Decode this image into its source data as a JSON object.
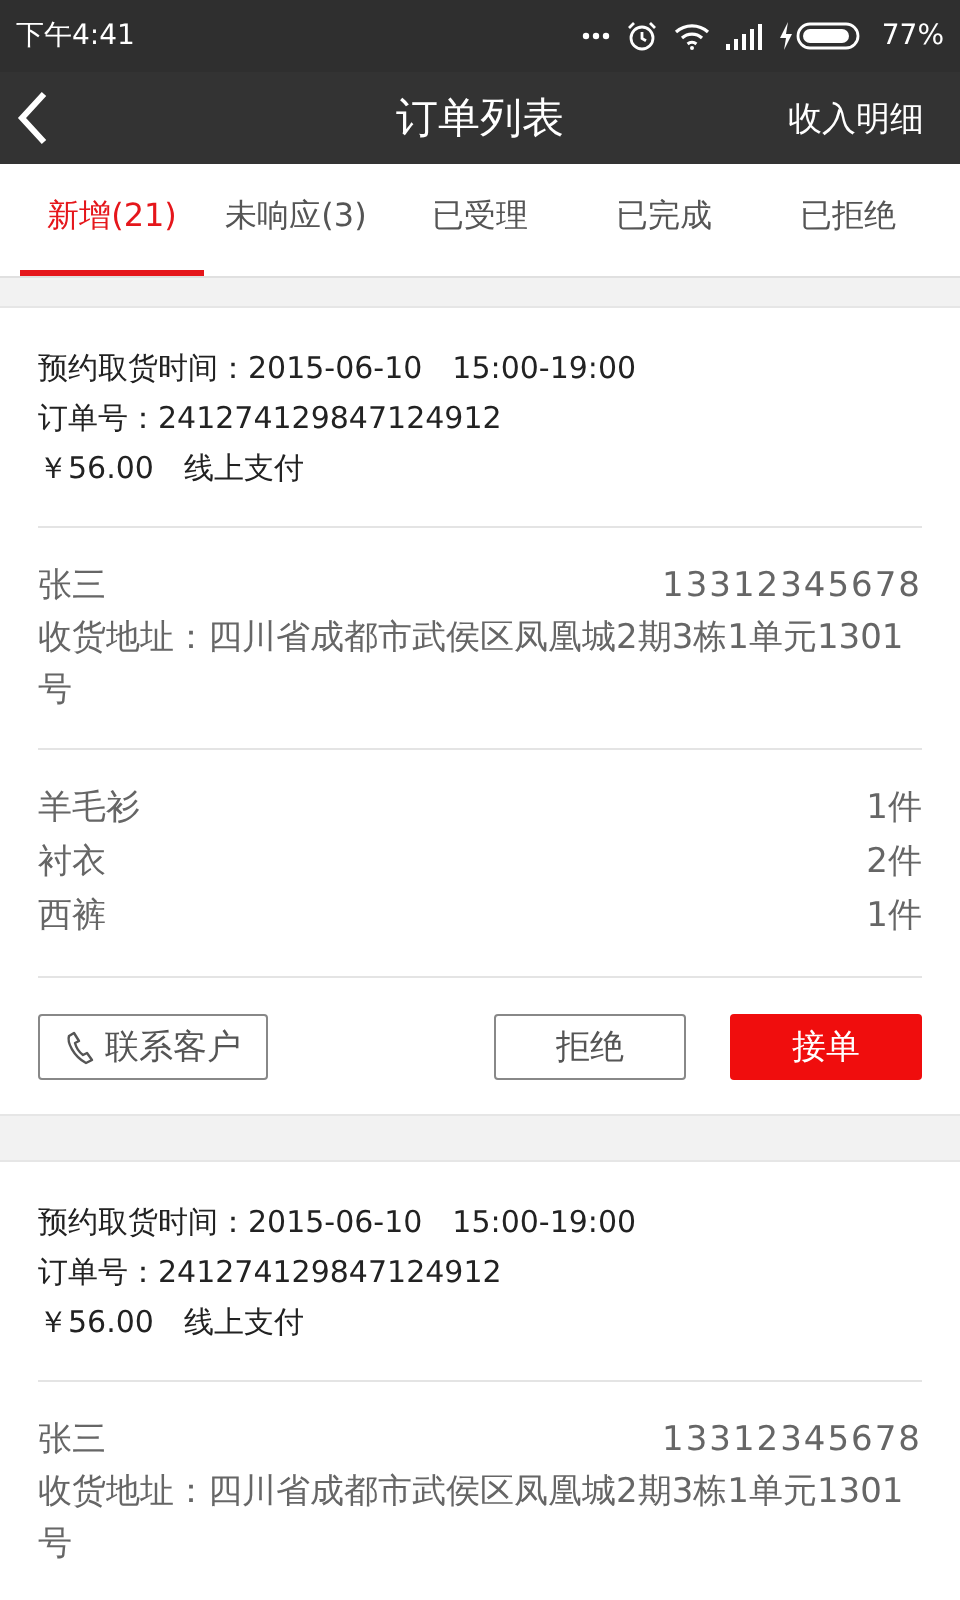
{
  "status_bar": {
    "time": "下午4:41",
    "battery": "77%"
  },
  "header": {
    "title": "订单列表",
    "action": "收入明细"
  },
  "tabs": [
    {
      "label": "新增(21)",
      "selected": true
    },
    {
      "label": "未响应(3)",
      "selected": false
    },
    {
      "label": "已受理",
      "selected": false
    },
    {
      "label": "已完成",
      "selected": false
    },
    {
      "label": "已拒绝",
      "selected": false
    }
  ],
  "orders": [
    {
      "pickup_time": "预约取货时间：2015-06-10　15:00-19:00",
      "order_no": "订单号：241274129847124912",
      "payment": "￥56.00　线上支付",
      "customer": "张三",
      "phone": "13312345678",
      "address": "收货地址：四川省成都市武侯区凤凰城2期3栋1单元1301号",
      "items": [
        {
          "name": "羊毛衫",
          "qty": "1件"
        },
        {
          "name": "衬衣",
          "qty": "2件"
        },
        {
          "name": "西裤",
          "qty": "1件"
        }
      ],
      "actions": {
        "contact": "联系客户",
        "reject": "拒绝",
        "accept": "接单"
      }
    },
    {
      "pickup_time": "预约取货时间：2015-06-10　15:00-19:00",
      "order_no": "订单号：241274129847124912",
      "payment": "￥56.00　线上支付",
      "customer": "张三",
      "phone": "13312345678",
      "address": "收货地址：四川省成都市武侯区凤凰城2期3栋1单元1301号"
    }
  ]
}
